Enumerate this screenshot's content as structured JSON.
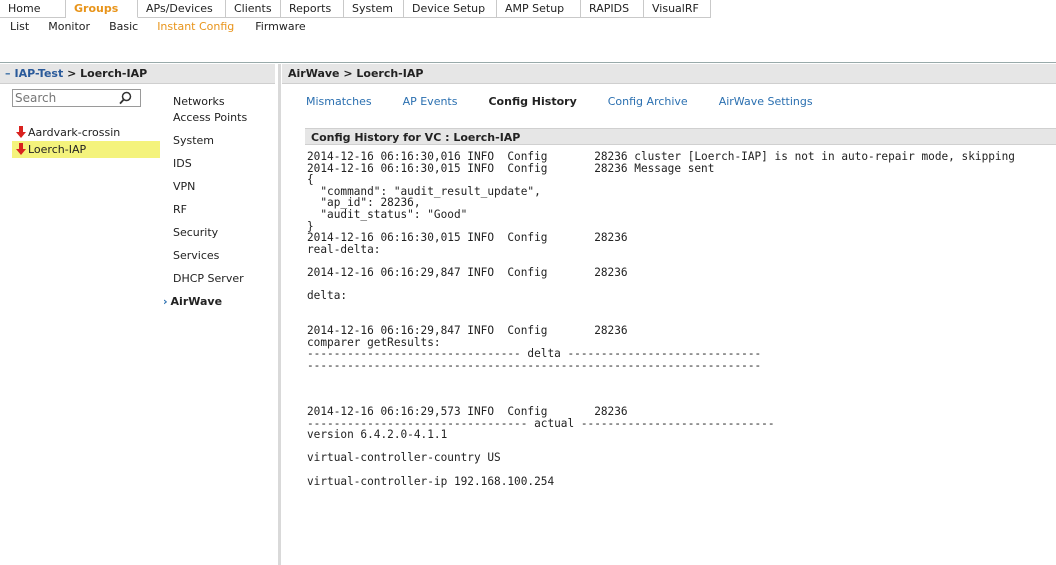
{
  "nav": {
    "tabs": [
      {
        "label": "Home"
      },
      {
        "label": "Groups"
      },
      {
        "label": "APs/Devices"
      },
      {
        "label": "Clients"
      },
      {
        "label": "Reports"
      },
      {
        "label": "System"
      },
      {
        "label": "Device Setup"
      },
      {
        "label": "AMP Setup"
      },
      {
        "label": "RAPIDS"
      },
      {
        "label": "VisualRF"
      }
    ],
    "subtabs": [
      {
        "label": "List"
      },
      {
        "label": "Monitor"
      },
      {
        "label": "Basic"
      },
      {
        "label": "Instant Config"
      },
      {
        "label": "Firmware"
      }
    ]
  },
  "left_panel": {
    "collapse_symbol": "–",
    "group_link": "IAP-Test",
    "separator": " > ",
    "current_group": "Loerch-IAP",
    "search_placeholder": "Search",
    "devices": [
      {
        "name": "Aardvark-crossin",
        "status": "down"
      },
      {
        "name": "Loerch-IAP",
        "status": "down"
      }
    ]
  },
  "config_menu": [
    {
      "label": "Networks"
    },
    {
      "label": "Access Points"
    },
    {
      "label": "System"
    },
    {
      "label": "IDS"
    },
    {
      "label": "VPN"
    },
    {
      "label": "RF"
    },
    {
      "label": "Security"
    },
    {
      "label": "Services"
    },
    {
      "label": "DHCP Server"
    },
    {
      "label": "AirWave"
    }
  ],
  "right_panel": {
    "breadcrumb": "AirWave > Loerch-IAP",
    "tabs": [
      {
        "label": "Mismatches"
      },
      {
        "label": "AP Events"
      },
      {
        "label": "Config History"
      },
      {
        "label": "Config Archive"
      },
      {
        "label": "AirWave Settings"
      }
    ],
    "panel_title": "Config History for VC : Loerch-IAP",
    "log": "2014-12-16 06:16:30,016 INFO  Config       28236 cluster [Loerch-IAP] is not in auto-repair mode, skipping\n2014-12-16 06:16:30,015 INFO  Config       28236 Message sent\n{\n  \"command\": \"audit_result_update\",\n  \"ap_id\": 28236,\n  \"audit_status\": \"Good\"\n}\n2014-12-16 06:16:30,015 INFO  Config       28236\nreal-delta:\n\n2014-12-16 06:16:29,847 INFO  Config       28236\n\ndelta:\n\n\n2014-12-16 06:16:29,847 INFO  Config       28236\ncomparer getResults:\n-------------------------------- delta -----------------------------\n--------------------------------------------------------------------\n\n\n\n2014-12-16 06:16:29,573 INFO  Config       28236\n--------------------------------- actual -----------------------------\nversion 6.4.2.0-4.1.1\n\nvirtual-controller-country US\n\nvirtual-controller-ip 192.168.100.254"
  },
  "colors": {
    "accent": "#e8941a",
    "link": "#2a6fb0",
    "selected_highlight": "#f4f37c",
    "status_down": "#d9221f",
    "header_bg": "#e6e6e6"
  }
}
